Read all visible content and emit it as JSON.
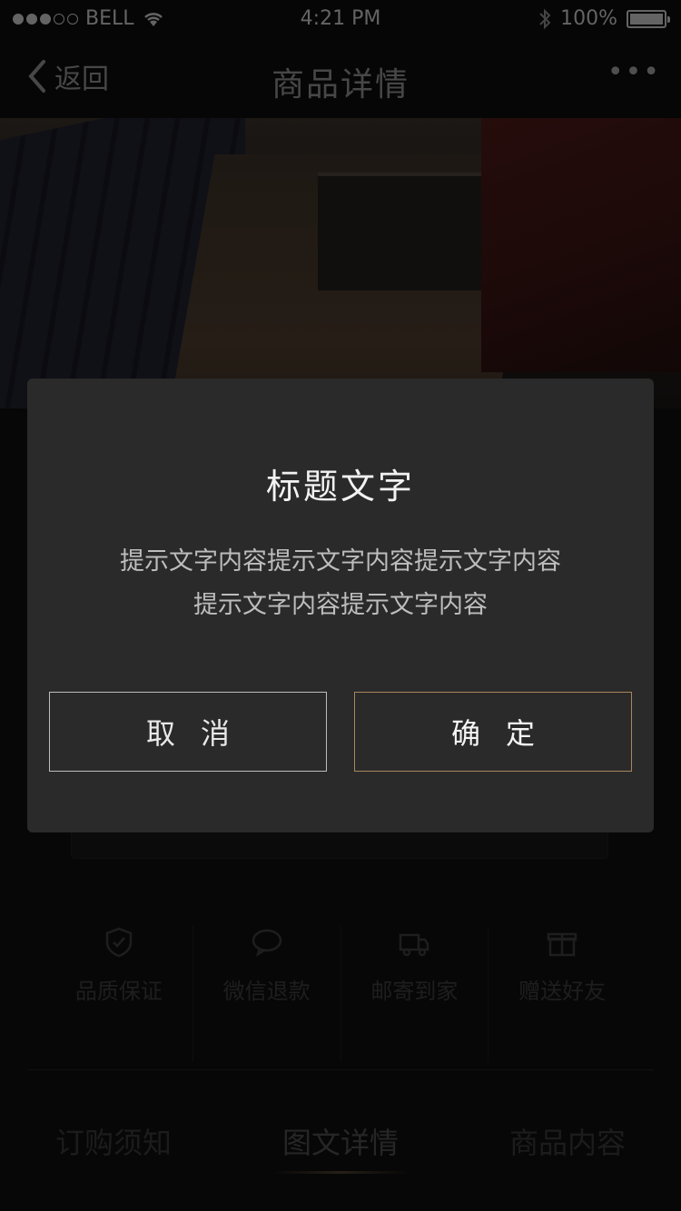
{
  "status_bar": {
    "carrier": "BELL",
    "time": "4:21 PM",
    "battery": "100%"
  },
  "nav": {
    "back_label": "返回",
    "title": "商品详情",
    "more_label": "•••"
  },
  "features": [
    {
      "label": "品质保证",
      "icon": "shield-check-icon"
    },
    {
      "label": "微信退款",
      "icon": "wechat-icon"
    },
    {
      "label": "邮寄到家",
      "icon": "truck-icon"
    },
    {
      "label": "赠送好友",
      "icon": "gift-icon"
    }
  ],
  "tabs": [
    {
      "label": "订购须知"
    },
    {
      "label": "图文详情",
      "active": true
    },
    {
      "label": "商品内容"
    }
  ],
  "dialog": {
    "title": "标题文字",
    "message_line1": "提示文字内容提示文字内容提示文字内容",
    "message_line2": "提示文字内容提示文字内容",
    "cancel_label": "取消",
    "confirm_label": "确定"
  },
  "colors": {
    "dialog_bg": "#2a2a2a",
    "confirm_border": "#a7875b",
    "cancel_border": "#bdbdbd"
  }
}
